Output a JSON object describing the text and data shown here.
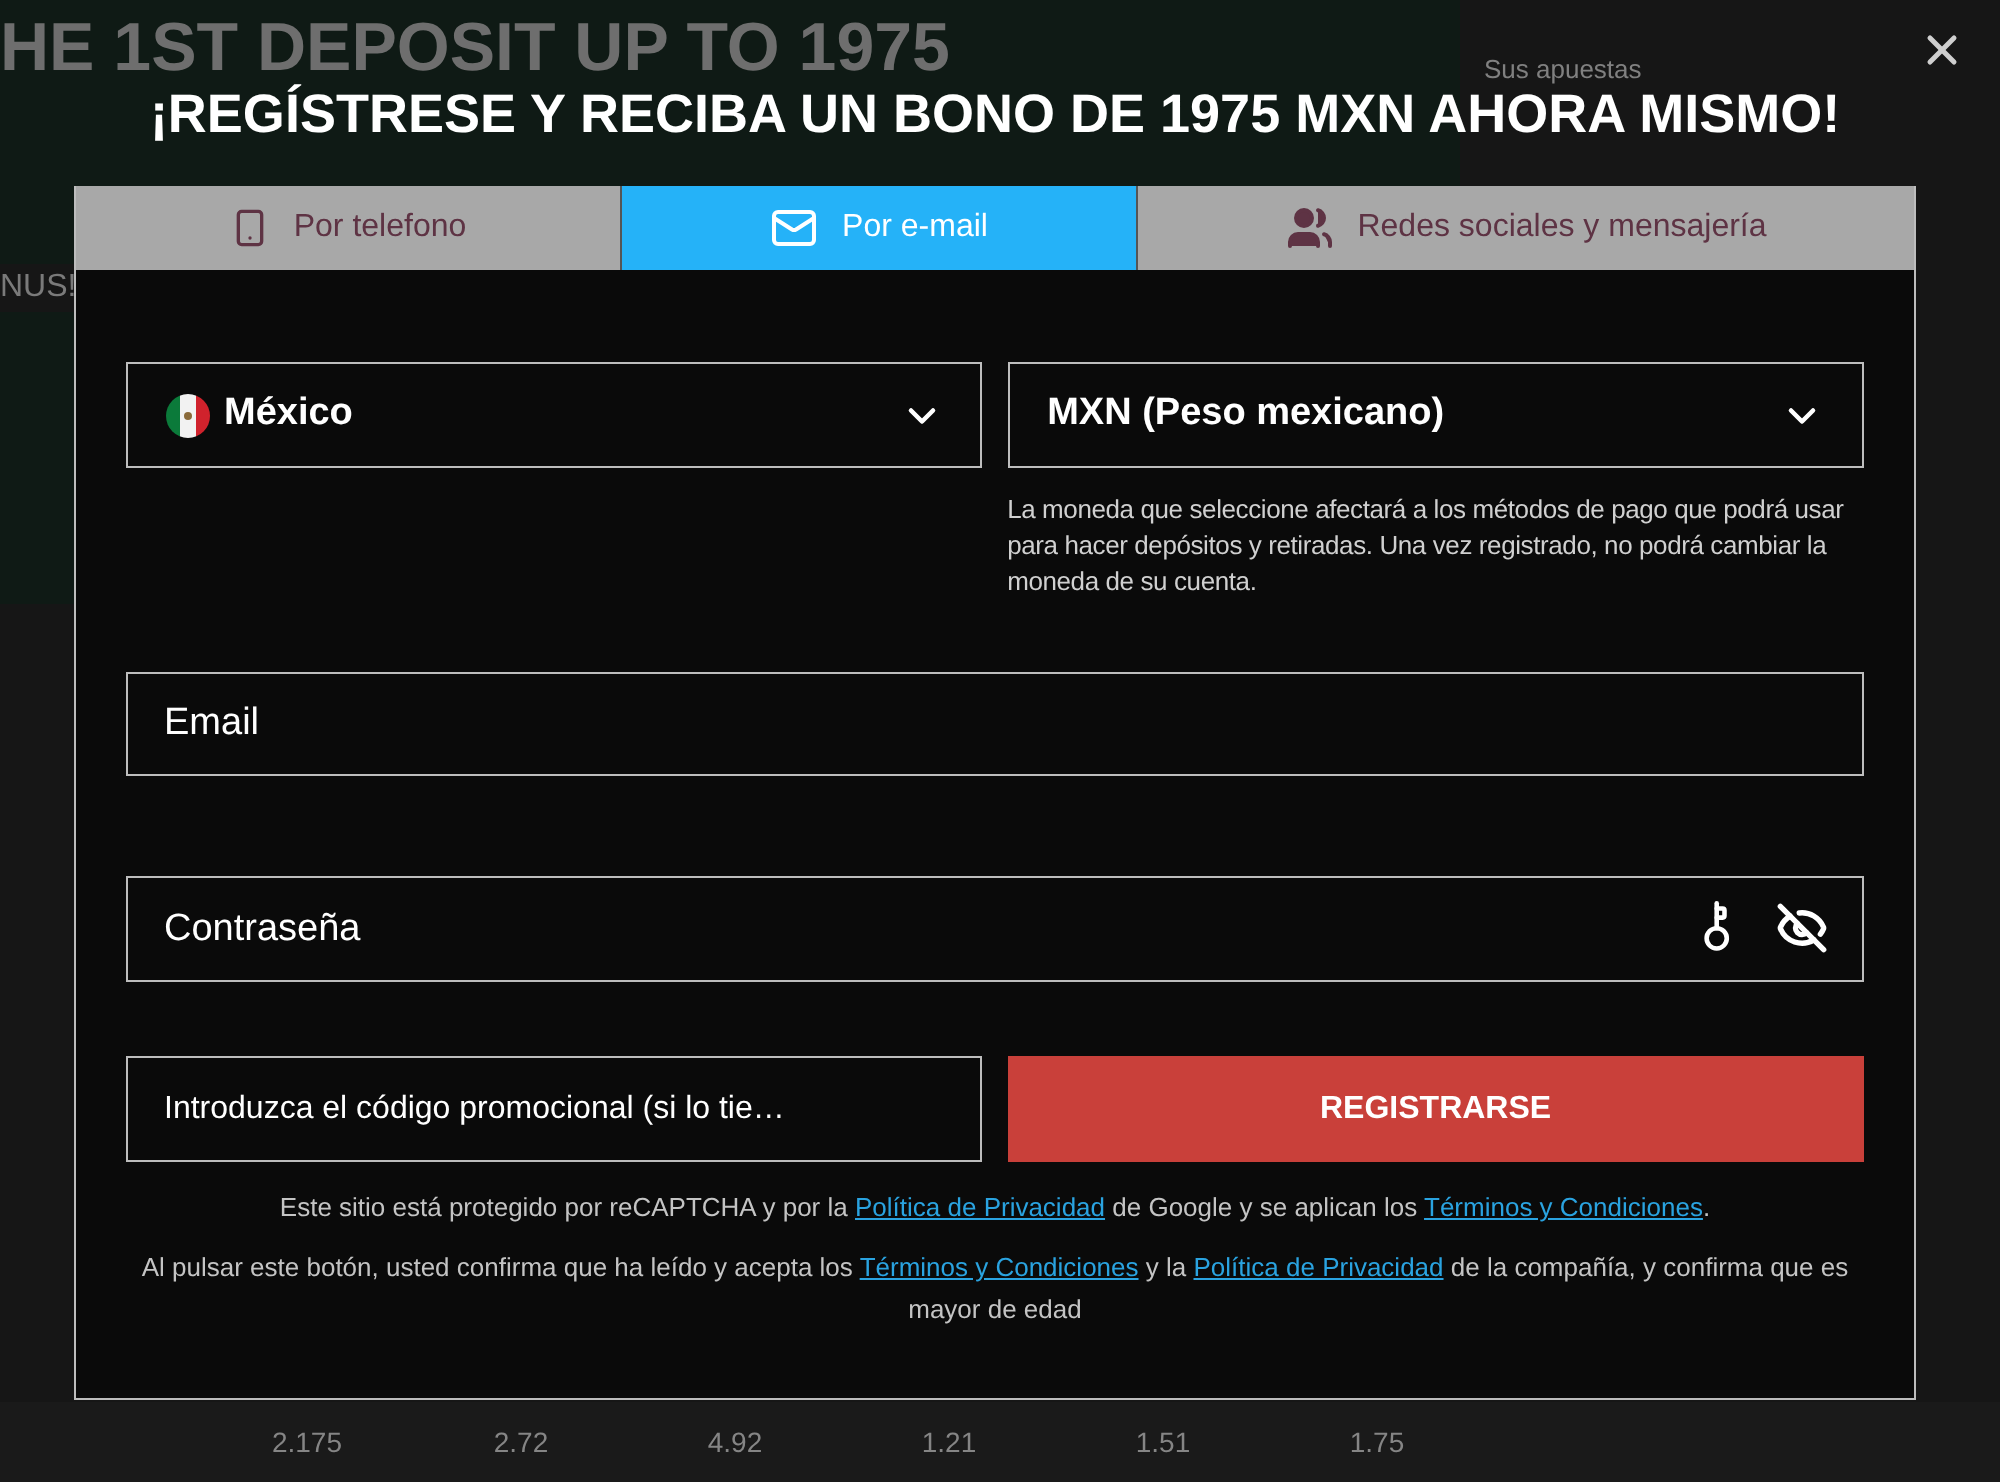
{
  "background": {
    "banner_text": "HE 1ST DEPOSIT UP TO 1975",
    "banner_side_text": "NUS!",
    "bet_slip_title": "Sus apuestas",
    "odds_row": [
      "2.175",
      "2.72",
      "4.92",
      "1.21",
      "1.51",
      "1.75"
    ]
  },
  "modal": {
    "title": "¡REGÍSTRESE Y RECIBA UN BONO DE 1975 MXN AHORA MISMO!",
    "tabs": [
      {
        "label": "Por telefono",
        "selected": false
      },
      {
        "label": "Por e-mail",
        "selected": true
      },
      {
        "label": "Redes sociales y mensajería",
        "selected": false
      }
    ],
    "country_select": {
      "value": "México"
    },
    "currency_select": {
      "value": "MXN (Peso mexicano)",
      "note": "La moneda que seleccione afectará a los métodos de pago que podrá usar para hacer depósitos y retiradas. Una vez registrado, no podrá cambiar la moneda de su cuenta."
    },
    "email_field": {
      "placeholder": "Email"
    },
    "password_field": {
      "placeholder": "Contraseña"
    },
    "promo_field": {
      "placeholder": "Introduzca el código promocional (si lo tie…"
    },
    "submit": "REGISTRARSE",
    "legal": [
      [
        {
          "kind": "text",
          "text": "Este sitio está protegido por reCAPTCHA y por la"
        },
        {
          "kind": "link",
          "text": "Política de Privacidad"
        },
        {
          "kind": "text",
          "text": "de Google y se aplican los"
        },
        {
          "kind": "link",
          "text": "Términos y Condiciones"
        },
        {
          "kind": "text",
          "text": "."
        }
      ],
      [
        {
          "kind": "text",
          "text": "Al pulsar este botón, usted confirma que ha leído y acepta los"
        },
        {
          "kind": "link",
          "text": "Términos y Condiciones"
        },
        {
          "kind": "text",
          "text": "y la"
        },
        {
          "kind": "link",
          "text": "Política de Privacidad"
        },
        {
          "kind": "text",
          "text": "de la compañía, y confirma que es mayor de edad"
        }
      ]
    ]
  }
}
